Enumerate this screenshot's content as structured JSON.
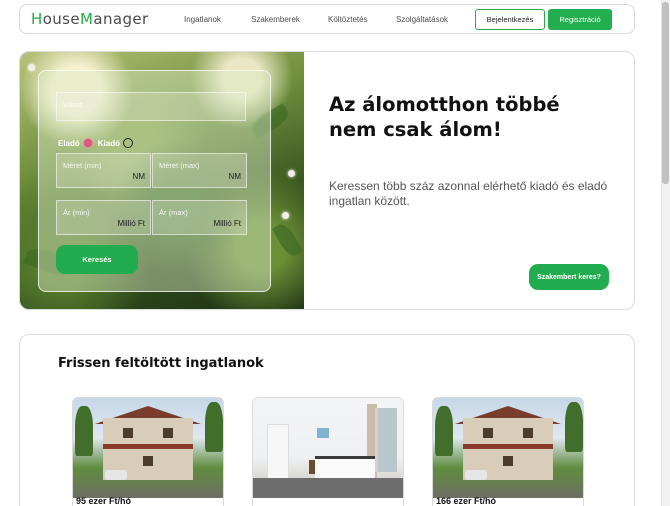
{
  "navbar": {
    "logo_prefix": "H",
    "logo_mid": "ouse",
    "logo_m": "M",
    "logo_suffix": "anager",
    "links": [
      "Ingatlanok",
      "Szakemberek",
      "Költöztetés",
      "Szolgáltatások"
    ],
    "login_label": "Bejelentkezés",
    "register_label": "Regisztráció"
  },
  "search": {
    "city_placeholder": "Város",
    "sale_label": "Eladó",
    "rent_label": "Kiadó",
    "size_min_placeholder": "Méret (min)",
    "size_max_placeholder": "Méret (max)",
    "size_unit": "NM",
    "price_min_placeholder": "Ár (min)",
    "price_max_placeholder": "Ár (max)",
    "price_unit": "Millió Ft",
    "search_button": "Keresés",
    "selected_mode": "Eladó"
  },
  "hero": {
    "title_line1": "Az álomotthon többé",
    "title_line2": "nem csak álom!",
    "subtitle": "Keressen több száz azonnal elérhető kiadó és eladó ingatlan között.",
    "expert_button": "Szakembert keres?"
  },
  "listings": {
    "title": "Frissen feltöltött ingatlanok",
    "items": [
      {
        "price": "95 ezer Ft/hó",
        "image": "house-photo"
      },
      {
        "price": "",
        "image": "bedroom-photo"
      },
      {
        "price": "166 ezer Ft/hó",
        "image": "house-photo"
      }
    ]
  },
  "colors": {
    "accent_green": "#22ad4e",
    "radio_selected": "#d8597a"
  }
}
